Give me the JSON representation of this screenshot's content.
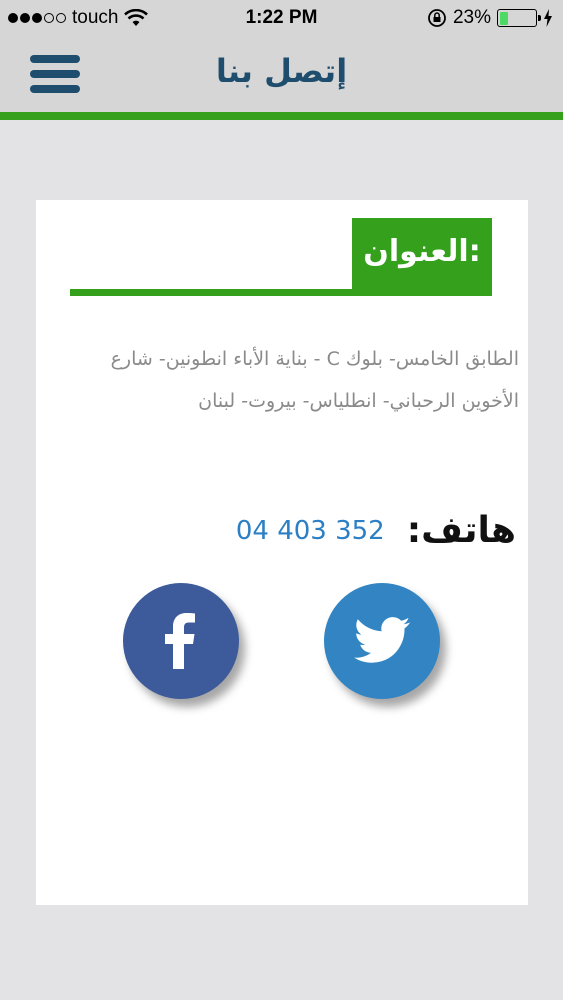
{
  "status_bar": {
    "carrier": "touch",
    "time": "1:22 PM",
    "battery_percent": "23%",
    "battery_level": 0.23,
    "signal_bars": 3
  },
  "nav": {
    "title": "إتصل بنا",
    "menu_icon": "hamburger-menu-icon"
  },
  "address": {
    "heading": "العنوان:",
    "line1": "الطابق الخامس- بلوك C - بناية الأباء انطونين- شارع",
    "line2": "الأخوين الرحباني- انطلياس- بيروت- لبنان"
  },
  "phone": {
    "label": "هاتف:",
    "number": "04 403 352"
  },
  "social": {
    "facebook_icon": "facebook-icon",
    "twitter_icon": "twitter-icon"
  },
  "colors": {
    "accent_green": "#34a01b",
    "nav_blue": "#1f4d6e",
    "phone_blue": "#2c7fc4",
    "facebook_blue": "#3d5b9a",
    "twitter_blue": "#3285c2"
  }
}
